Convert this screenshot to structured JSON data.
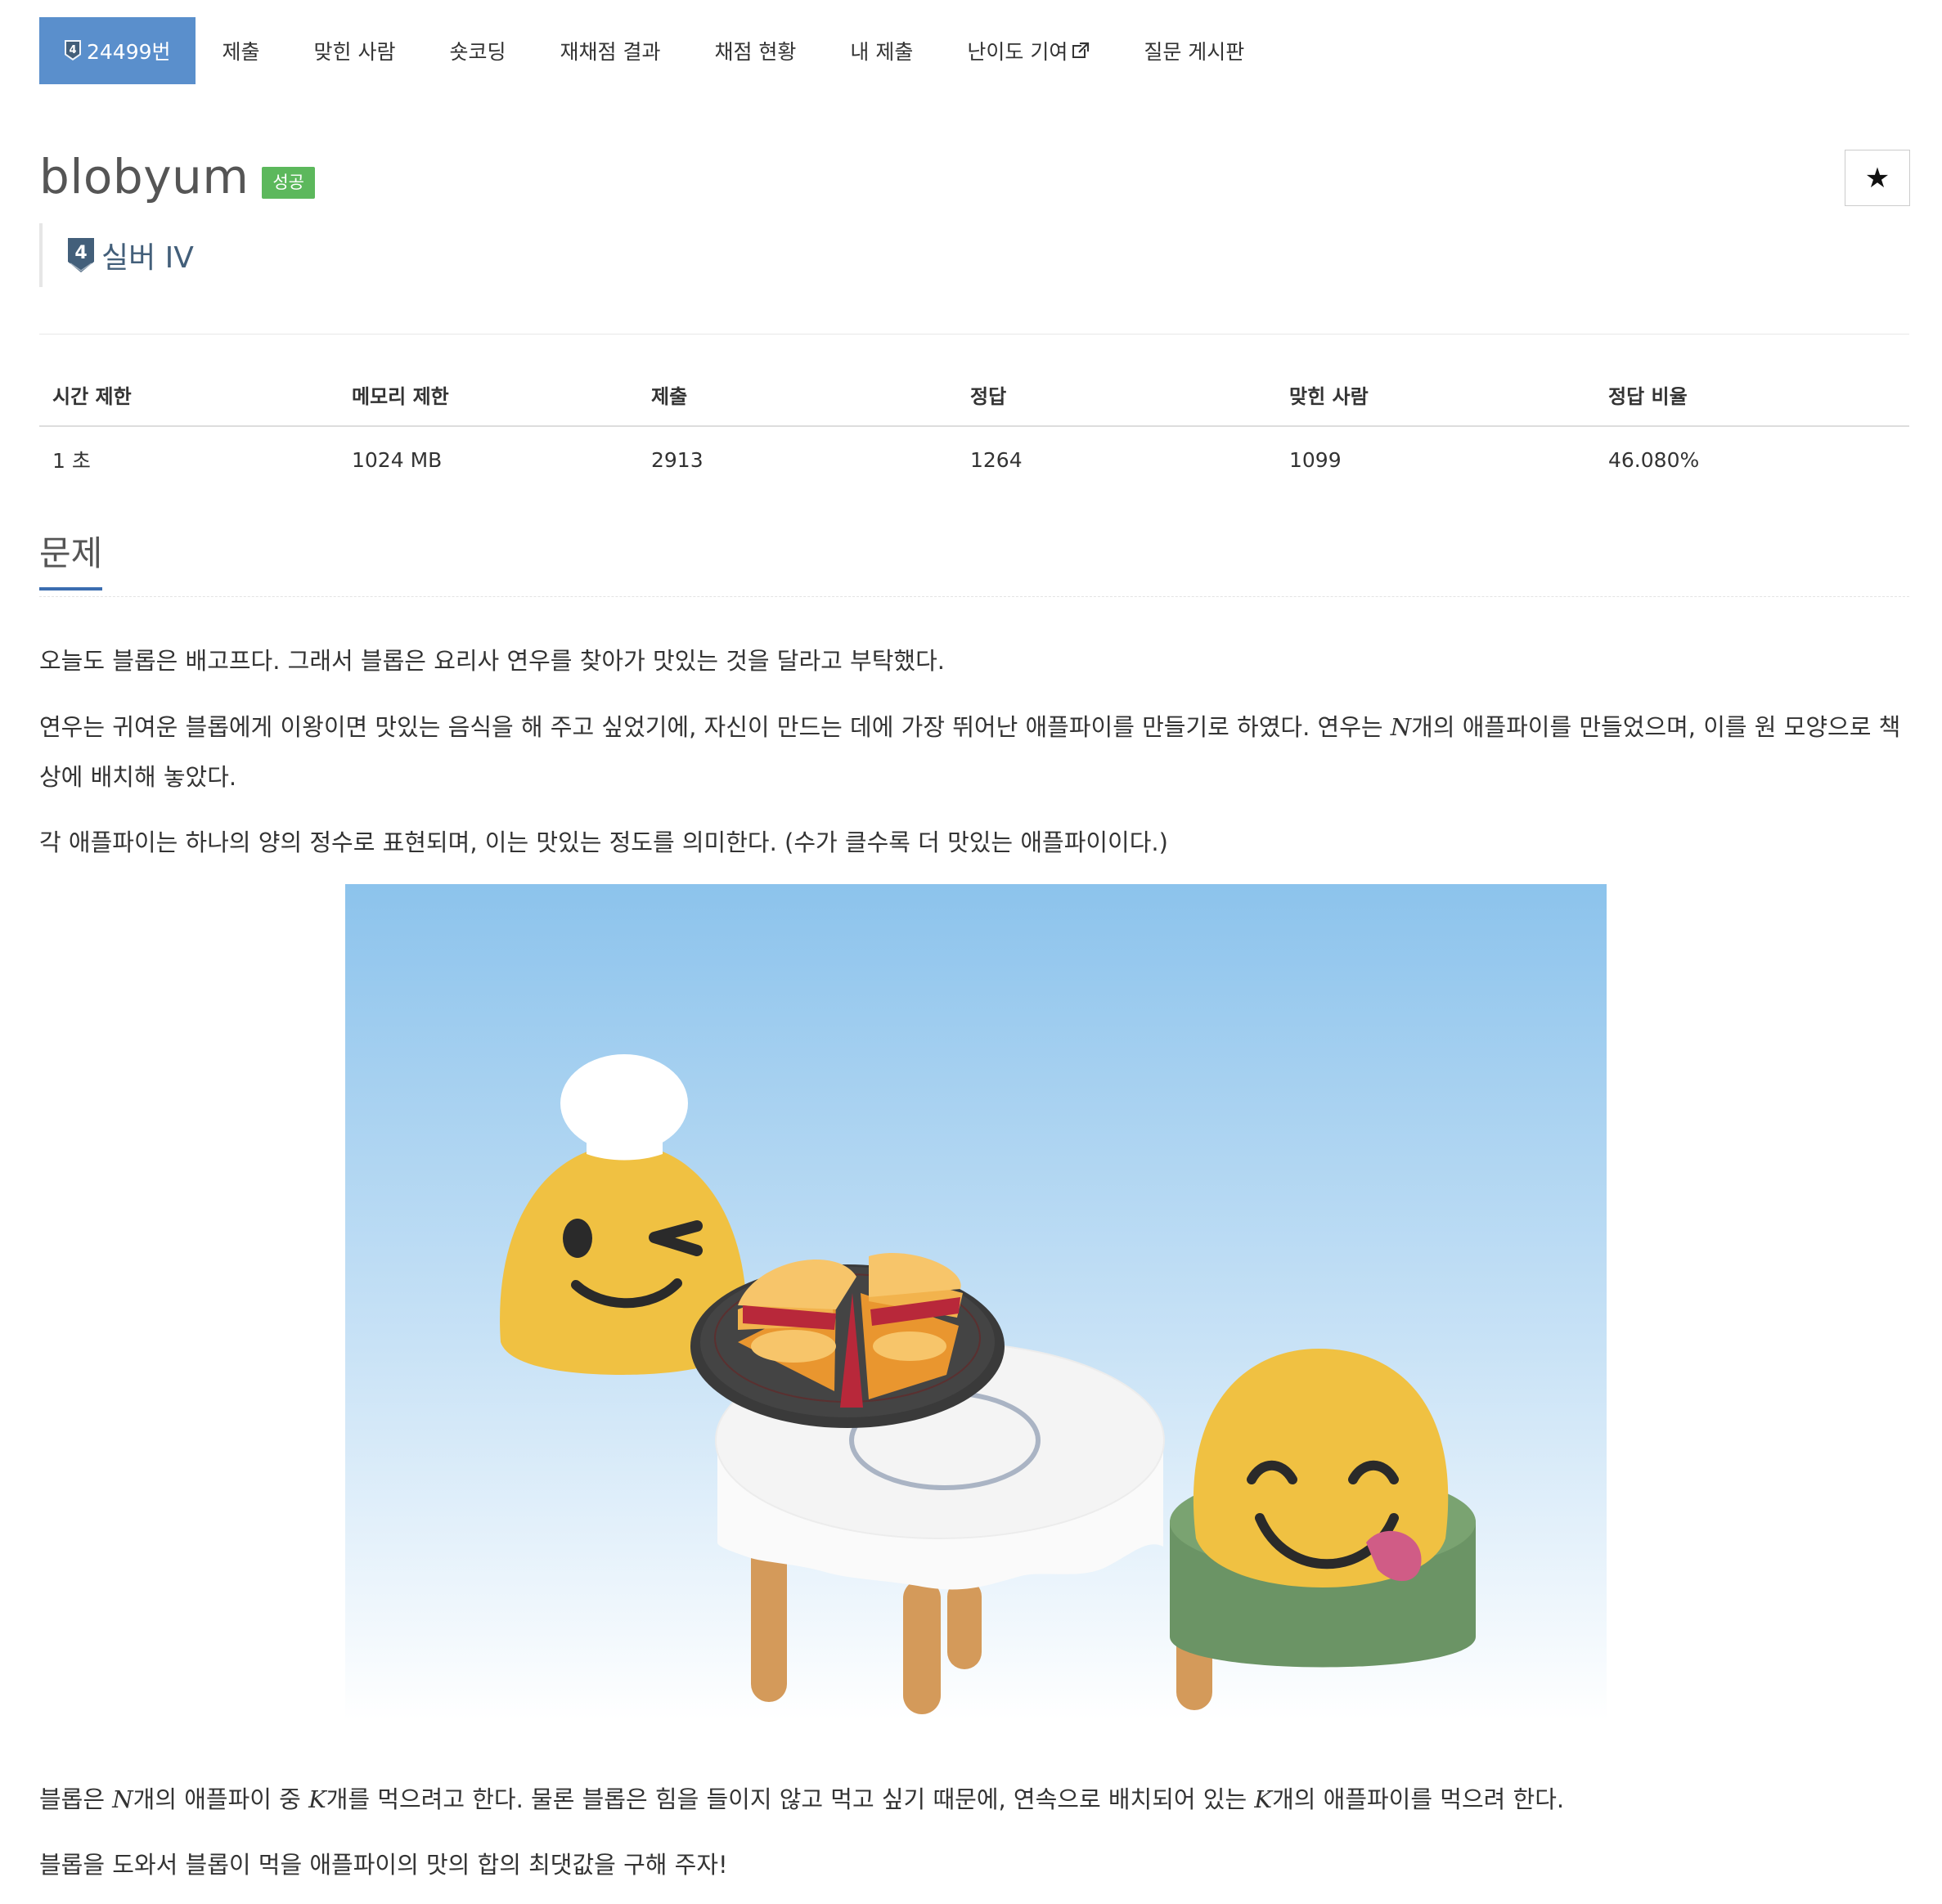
{
  "nav": {
    "tier_badge": "4",
    "problem_tab": "24499번",
    "items": [
      "제출",
      "맞힌 사람",
      "숏코딩",
      "재채점 결과",
      "채점 현황",
      "내 제출",
      "난이도 기여",
      "질문 게시판"
    ]
  },
  "problem": {
    "title": "blobyum",
    "result": "성공",
    "tier_number": "4",
    "tier_label": "실버 IV",
    "star": "★"
  },
  "stats": {
    "headers": [
      "시간 제한",
      "메모리 제한",
      "제출",
      "정답",
      "맞힌 사람",
      "정답 비율"
    ],
    "values": [
      "1 초",
      "1024 MB",
      "2913",
      "1264",
      "1099",
      "46.080%"
    ]
  },
  "section": {
    "title": "문제"
  },
  "description": {
    "p1": "오늘도 블롭은 배고프다. 그래서 블롭은 요리사 연우를 찾아가 맛있는 것을 달라고 부탁했다.",
    "p2_before": "연우는 귀여운 블롭에게 이왕이면 맛있는 음식을 해 주고 싶었기에, 자신이 만드는 데에 가장 뛰어난 애플파이를 만들기로 하였다. 연우는 ",
    "p2_var": "N",
    "p2_after": "개의 애플파이를 만들었으며, 이를 원 모양으로 책상에 배치해 놓았다.",
    "p3": "각 애플파이는 하나의 양의 정수로 표현되며, 이는 맛있는 정도를 의미한다. (수가 클수록 더 맛있는 애플파이이다.)",
    "p4_a": "블롭은 ",
    "p4_var1": "N",
    "p4_b": "개의 애플파이 중 ",
    "p4_var2": "K",
    "p4_c": "개를 먹으려고 한다. 물론 블롭은 힘을 들이지 않고 먹고 싶기 때문에, 연속으로 배치되어 있는 ",
    "p4_var3": "K",
    "p4_d": "개의 애플파이를 먹으려 한다.",
    "p5": "블롭을 도와서 블롭이 먹을 애플파이의 맛의 합의 최댓값을 구해 주자!"
  },
  "colors": {
    "accent": "#5a8fcc",
    "success": "#5cb85c",
    "tier_silver": "#435f7a",
    "blob": "#f0c142",
    "sky_top": "#8cc3ec",
    "cushion": "#6b9465"
  }
}
